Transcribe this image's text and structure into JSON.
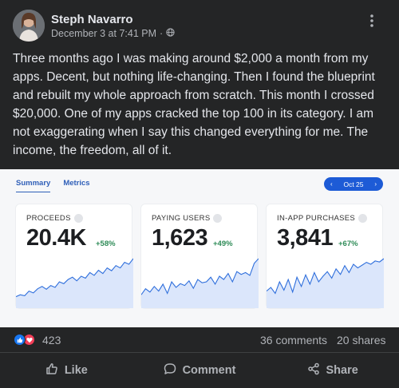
{
  "post": {
    "author": "Steph Navarro",
    "timestamp": "December 3 at 7:41 PM",
    "separator": "·",
    "audience_icon": "globe-icon",
    "text": "Three months ago I was making around $2,000 a month from my apps. Decent, but nothing life-changing. Then I found the blueprint and rebuilt my whole approach from scratch. This month I crossed $20,000. One of my apps cracked the top 100 in its category. I am not exaggerating when I say this changed everything for me. The income, the freedom, all of it."
  },
  "embed": {
    "tabs": [
      {
        "label": "Summary",
        "active": true
      },
      {
        "label": "Metrics",
        "active": false
      }
    ],
    "date_range": {
      "label": "Oct 25",
      "prev": "‹",
      "next": "›"
    },
    "cards": [
      {
        "label": "PROCEEDS",
        "value": "20.4K",
        "delta": "+58%",
        "spark": [
          0.18,
          0.22,
          0.2,
          0.3,
          0.26,
          0.35,
          0.4,
          0.34,
          0.42,
          0.38,
          0.5,
          0.46,
          0.55,
          0.6,
          0.52,
          0.62,
          0.58,
          0.7,
          0.64,
          0.75,
          0.68,
          0.8,
          0.74,
          0.85,
          0.8,
          0.92,
          0.88,
          1.0
        ]
      },
      {
        "label": "PAYING USERS",
        "value": "1,623",
        "delta": "+49%",
        "spark": [
          0.22,
          0.35,
          0.28,
          0.4,
          0.3,
          0.45,
          0.25,
          0.5,
          0.38,
          0.46,
          0.42,
          0.52,
          0.36,
          0.55,
          0.48,
          0.5,
          0.6,
          0.45,
          0.62,
          0.55,
          0.68,
          0.5,
          0.72,
          0.66,
          0.7,
          0.64,
          0.9,
          1.0
        ]
      },
      {
        "label": "IN-APP PURCHASES",
        "value": "3,841",
        "delta": "+67%",
        "spark": [
          0.3,
          0.38,
          0.25,
          0.5,
          0.32,
          0.55,
          0.28,
          0.6,
          0.4,
          0.65,
          0.45,
          0.7,
          0.5,
          0.62,
          0.72,
          0.58,
          0.78,
          0.66,
          0.85,
          0.7,
          0.88,
          0.8,
          0.86,
          0.92,
          0.88,
          0.95,
          0.93,
          1.0
        ]
      }
    ],
    "colors": {
      "accent": "#1d5bd6",
      "line": "#2f6fdc",
      "fill": "#dbe6fb",
      "positive": "#2e8b57"
    }
  },
  "engagement": {
    "reaction_icons": [
      "like-icon",
      "love-icon"
    ],
    "reaction_count": "423",
    "comments": "36 comments",
    "shares": "20 shares"
  },
  "actions": {
    "like": "Like",
    "comment": "Comment",
    "share": "Share"
  }
}
